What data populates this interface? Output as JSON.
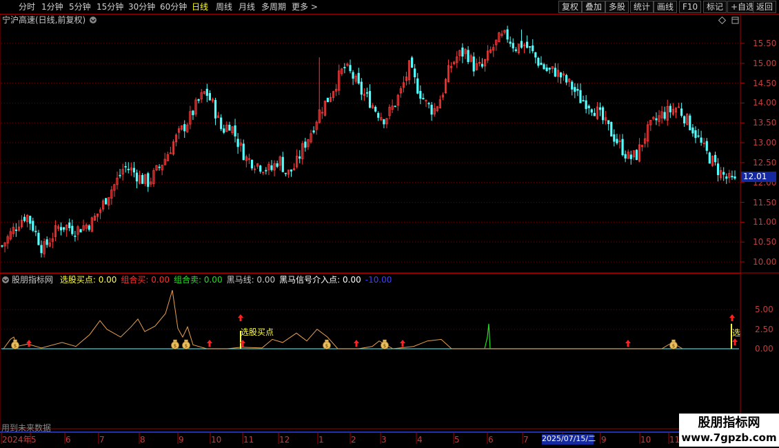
{
  "toolbar": {
    "periods": [
      "分时",
      "1分钟",
      "5分钟",
      "15分钟",
      "30分钟",
      "60分钟",
      "日线",
      "周线",
      "月线",
      "多周期",
      "更多 >"
    ],
    "active": "日线",
    "right": [
      "复权",
      "叠加",
      "多股",
      "统计",
      "画线",
      "F10",
      "标记",
      "+自选",
      "返回"
    ]
  },
  "main": {
    "title": "宁沪高速(日线,前复权)",
    "price_ticks": [
      "15.50",
      "15.00",
      "14.50",
      "14.00",
      "13.50",
      "13.00",
      "12.50",
      "12.00",
      "11.50",
      "11.00",
      "10.50",
      "10.00"
    ],
    "current_price": "12.01"
  },
  "indicator": {
    "name": "股朋指标网",
    "items": [
      {
        "label": "选股买点: 0.00",
        "color": "#ffff40"
      },
      {
        "label": "组合买: 0.00",
        "color": "#ff3030"
      },
      {
        "label": "组合卖: 0.00",
        "color": "#20e020"
      },
      {
        "label": "黑马线: 0.00",
        "color": "#c8c8c8"
      },
      {
        "label": "黑马信号介入点: 0.00",
        "color": "#ffffff"
      },
      {
        "label": "-10.00",
        "color": "#4040ff"
      }
    ],
    "ticks": [
      "5.00",
      "2.50",
      "0.00"
    ],
    "annotation": "选股买点",
    "edge_annotation": "选"
  },
  "footer": {
    "note": "用到未来数据"
  },
  "xaxis": {
    "labels": [
      "2024年",
      "5",
      "6",
      "7",
      "8",
      "9",
      "10",
      "11",
      "12",
      "1",
      "2",
      "3",
      "4",
      "5",
      "6",
      "7",
      "8",
      "9",
      "10",
      "11"
    ],
    "highlight": "2025/07/15/二"
  },
  "watermark": {
    "line1": "股朋指标网",
    "line2": "www.7gpzb.com"
  },
  "chart_data": {
    "type": "candlestick",
    "series": [
      {
        "name": "宁沪高速",
        "values": [
          10.4,
          10.7,
          11.0,
          11.2,
          10.8,
          10.3,
          10.6,
          10.9,
          10.9,
          10.8,
          10.9,
          11.0,
          11.3,
          11.7,
          12.0,
          12.4,
          12.3,
          12.1,
          12.0,
          12.3,
          12.6,
          13.0,
          13.3,
          13.6,
          14.0,
          14.3,
          13.9,
          13.3,
          13.5,
          13.0,
          12.6,
          12.5,
          12.4,
          12.3,
          12.6,
          12.2,
          12.4,
          12.9,
          13.3,
          13.8,
          14.1,
          14.5,
          14.9,
          14.7,
          14.3,
          14.1,
          13.8,
          13.6,
          13.9,
          14.3,
          14.9,
          14.4,
          14.0,
          13.8,
          14.2,
          14.9,
          15.2,
          15.3,
          14.9,
          14.9,
          15.3,
          15.6,
          15.7,
          15.4,
          15.5,
          15.3,
          15.0,
          14.8,
          14.8,
          14.6,
          14.4,
          14.1,
          14.0,
          13.8,
          13.5,
          13.2,
          12.9,
          12.6,
          12.7,
          13.2,
          13.5,
          13.7,
          13.8,
          13.9,
          13.6,
          13.3,
          12.9,
          12.6,
          12.3,
          12.1,
          12.0
        ]
      }
    ],
    "ylim": [
      10.0,
      15.5
    ],
    "indicator_series": [
      {
        "name": "黑马线",
        "ylim": [
          0,
          7.5
        ]
      }
    ]
  }
}
